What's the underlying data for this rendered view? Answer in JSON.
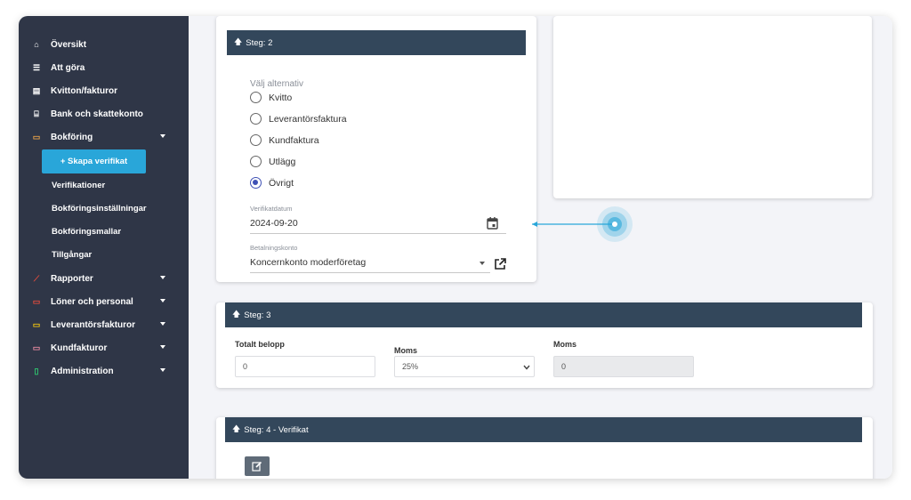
{
  "sidebar": {
    "items": [
      {
        "label": "Översikt",
        "icon": "home-icon",
        "glyph": "⌂",
        "color": "#ffffff"
      },
      {
        "label": "Att göra",
        "icon": "list-icon",
        "glyph": "☰",
        "color": "#ffffff"
      },
      {
        "label": "Kvitton/fakturor",
        "icon": "receipt-icon",
        "glyph": "▤",
        "color": "#ffffff"
      },
      {
        "label": "Bank och skattekonto",
        "icon": "bank-icon",
        "glyph": "⌸",
        "color": "#ffffff"
      },
      {
        "label": "Bokföring",
        "icon": "book-icon",
        "glyph": "▭",
        "color": "#e8a24a"
      }
    ],
    "create_button": "+ Skapa verifikat",
    "sub_items": [
      "Verifikationer",
      "Bokföringsinställningar",
      "Bokföringsmallar",
      "Tillgångar"
    ],
    "items_after": [
      {
        "label": "Rapporter",
        "icon": "chart-icon",
        "glyph": "⟋",
        "color": "#e74c3c"
      },
      {
        "label": "Löner och personal",
        "icon": "payroll-icon",
        "glyph": "▭",
        "color": "#e74c3c"
      },
      {
        "label": "Leverantörsfakturor",
        "icon": "invoice-icon",
        "glyph": "▭",
        "color": "#f1c40f"
      },
      {
        "label": "Kundfakturor",
        "icon": "customer-invoice-icon",
        "glyph": "▭",
        "color": "#e88aa0"
      },
      {
        "label": "Administration",
        "icon": "admin-icon",
        "glyph": "▯",
        "color": "#2ecc71"
      }
    ]
  },
  "step2": {
    "title": "Steg: 2",
    "options_label": "Välj alternativ",
    "options": [
      "Kvitto",
      "Leverantörsfaktura",
      "Kundfaktura",
      "Utlägg",
      "Övrigt"
    ],
    "selected_option": "Övrigt",
    "date_label": "Verifikatdatum",
    "date_value": "2024-09-20",
    "account_label": "Betalningskonto",
    "account_value": "Koncernkonto moderföretag"
  },
  "step3": {
    "title": "Steg: 3",
    "total_label": "Totalt belopp",
    "total_value": "0",
    "moms_select_label": "Moms",
    "moms_select_value": "25%",
    "moms_label": "Moms",
    "moms_value": "0"
  },
  "step4": {
    "title": "Steg: 4 - Verifikat"
  },
  "colors": {
    "sidebar_bg": "#2f3647",
    "header_bg": "#33475b",
    "accent": "#29a6d9",
    "radio_checked": "#3f51b5"
  }
}
